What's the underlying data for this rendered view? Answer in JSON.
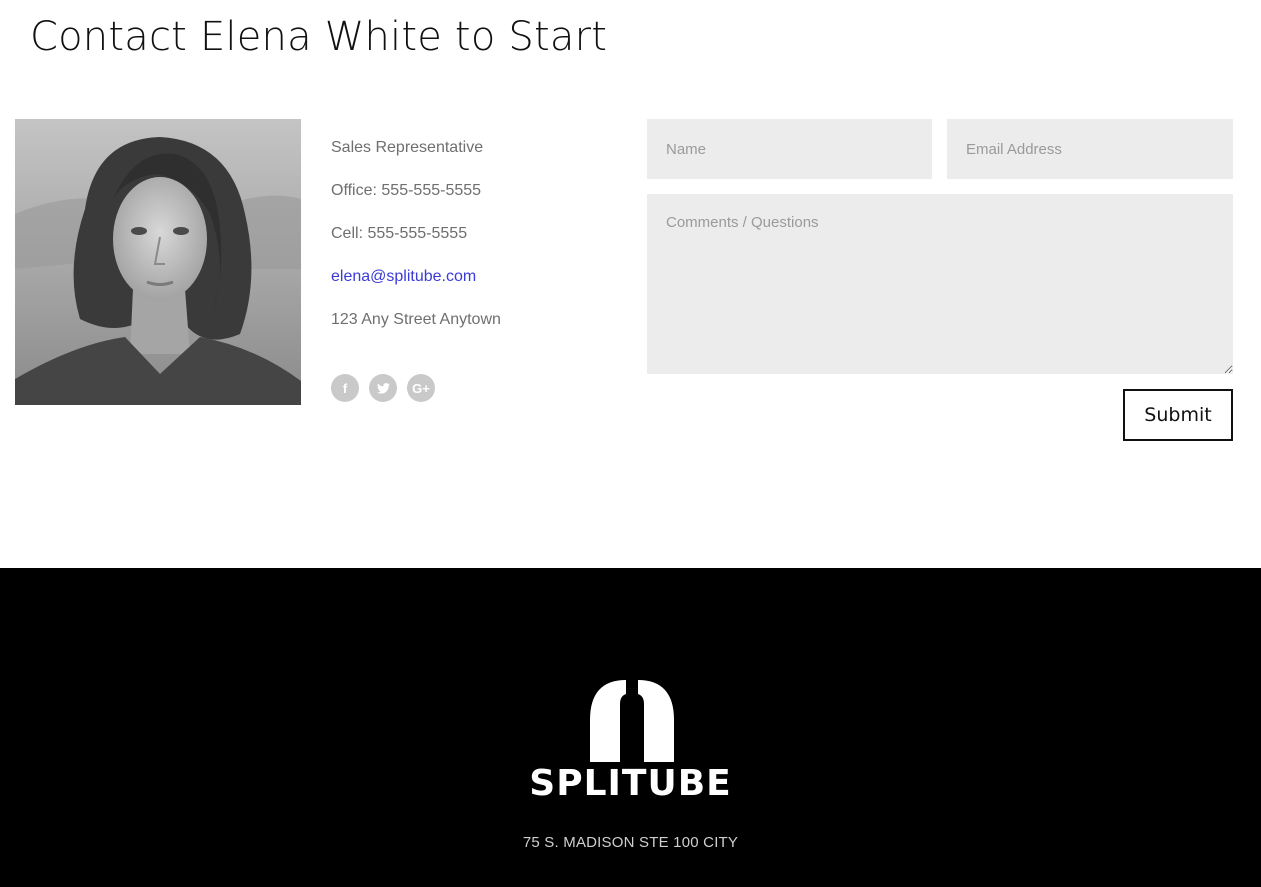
{
  "page": {
    "title": "Contact Elena White to Start"
  },
  "agent": {
    "photo_alt": "Elena White portrait",
    "role": "Sales Representative",
    "office": "Office: 555-555-5555",
    "cell": "Cell: 555-555-5555",
    "email": "elena@splitube.com",
    "address": "123 Any Street Anytown",
    "social": [
      {
        "name": "facebook-icon",
        "glyph": "f"
      },
      {
        "name": "twitter-icon",
        "glyph": "t"
      },
      {
        "name": "google-plus-icon",
        "glyph": "G+"
      }
    ]
  },
  "form": {
    "name_placeholder": "Name",
    "email_placeholder": "Email Address",
    "comments_placeholder": "Comments / Questions",
    "submit_label": "Submit"
  },
  "footer": {
    "brand": "SPLITUBE",
    "address": "75 S. MADISON STE 100 CITY"
  },
  "colors": {
    "link": "#3b3bd6",
    "field_bg": "#ececec",
    "footer_bg": "#000000"
  }
}
